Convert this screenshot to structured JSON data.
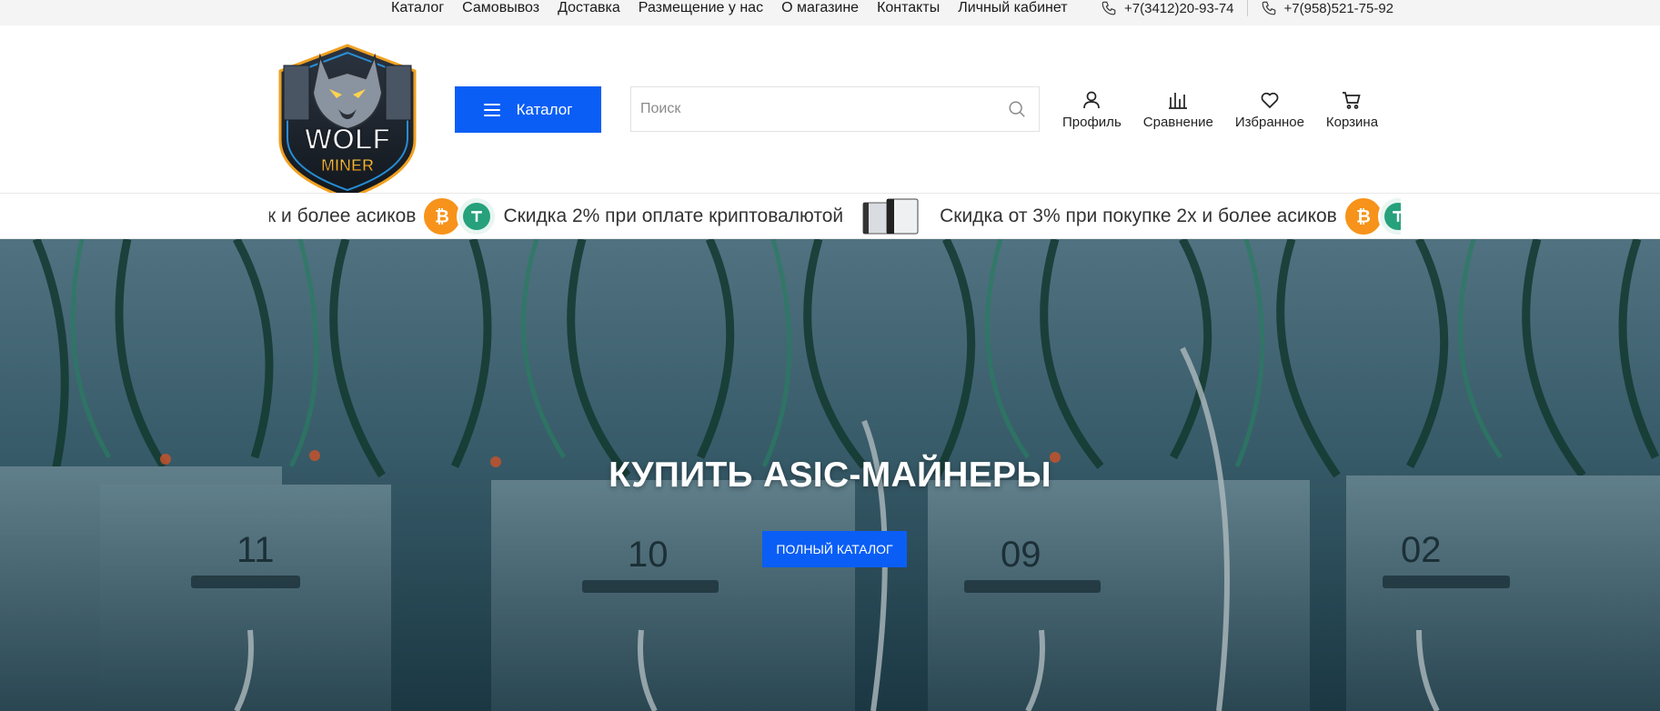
{
  "topbar": {
    "nav": [
      {
        "label": "Каталог"
      },
      {
        "label": "Самовывоз"
      },
      {
        "label": "Доставка"
      },
      {
        "label": "Размещение у нас"
      },
      {
        "label": "О магазине"
      },
      {
        "label": "Контакты"
      },
      {
        "label": "Личный кабинет"
      }
    ],
    "phones": [
      {
        "number": "+7(3412)20-93-74",
        "icon": "phone-icon"
      },
      {
        "number": "+7(958)521-75-92",
        "icon": "phone-icon"
      }
    ]
  },
  "header": {
    "logo": {
      "line1": "WOLF",
      "line2": "MINER"
    },
    "catalog_button": "Каталог",
    "search": {
      "placeholder": "Поиск",
      "value": ""
    },
    "actions": [
      {
        "label": "Профиль",
        "icon": "user-icon"
      },
      {
        "label": "Сравнение",
        "icon": "compare-icon"
      },
      {
        "label": "Избранное",
        "icon": "heart-icon"
      },
      {
        "label": "Корзина",
        "icon": "cart-icon"
      }
    ]
  },
  "ticker": {
    "partial_text": "к и более асиков",
    "items": [
      "Скидка 2% при оплате криптовалютой",
      "Скидка от 3% при покупке 2х и более асиков"
    ],
    "coin_icons": [
      "bitcoin-icon",
      "tether-icon"
    ]
  },
  "hero": {
    "title": "КУПИТЬ ASIC-МАЙНЕРЫ",
    "button": "ПОЛНЫЙ КАТАЛОГ",
    "rack_labels": [
      "11",
      "10",
      "09",
      "02"
    ]
  },
  "colors": {
    "accent": "#0a5ef5",
    "topbar_bg": "#f4f4f4",
    "bitcoin": "#f7931a",
    "tether": "#26a17b"
  }
}
